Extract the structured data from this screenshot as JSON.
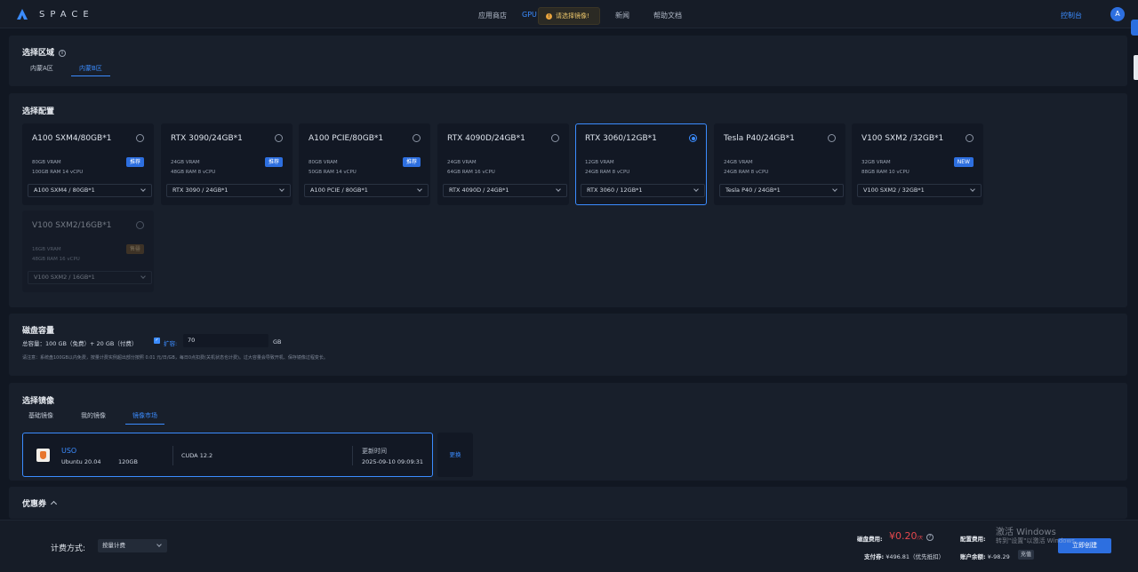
{
  "header": {
    "logo_text": "SPACE",
    "nav": [
      "应用商店",
      "GPU",
      "新闻",
      "帮助文档"
    ],
    "active_nav": "GPU",
    "console": "控制台",
    "avatar": "A",
    "toast": "请选择镜像!"
  },
  "region": {
    "title": "选择区域",
    "tabs": [
      "内蒙A区",
      "内蒙B区"
    ],
    "active_tab": "内蒙B区"
  },
  "config": {
    "title": "选择配置",
    "cards": [
      {
        "name": "A100 SXM4/80GB*1",
        "vram": "80GB VRAM",
        "specs": "100GB RAM 14 vCPU",
        "badge": "推荐",
        "option": "A100 SXM4 / 80GB*1",
        "selected": false
      },
      {
        "name": "RTX 3090/24GB*1",
        "vram": "24GB VRAM",
        "specs": "48GB RAM 8 vCPU",
        "badge": "推荐",
        "option": "RTX 3090 / 24GB*1",
        "selected": false
      },
      {
        "name": "A100 PCIE/80GB*1",
        "vram": "80GB VRAM",
        "specs": "50GB RAM 14 vCPU",
        "badge": "推荐",
        "option": "A100 PCIE / 80GB*1",
        "selected": false
      },
      {
        "name": "RTX 4090D/24GB*1",
        "vram": "24GB VRAM",
        "specs": "64GB RAM 16 vCPU",
        "badge": "",
        "option": "RTX 4090D / 24GB*1",
        "selected": false
      },
      {
        "name": "RTX 3060/12GB*1",
        "vram": "12GB VRAM",
        "specs": "24GB RAM 8 vCPU",
        "badge": "",
        "option": "RTX 3060 / 12GB*1",
        "selected": true
      },
      {
        "name": "Tesla P40/24GB*1",
        "vram": "24GB VRAM",
        "specs": "24GB RAM 8 vCPU",
        "badge": "",
        "option": "Tesla P40 / 24GB*1",
        "selected": false
      },
      {
        "name": "V100 SXM2 /32GB*1",
        "vram": "32GB VRAM",
        "specs": "88GB RAM 10 vCPU",
        "badge": "NEW",
        "option": "V100 SXM2 / 32GB*1",
        "selected": false
      },
      {
        "name": "V100 SXM2/16GB*1",
        "vram": "16GB VRAM",
        "specs": "48GB RAM 16 vCPU",
        "badge": "售罄",
        "option": "V100 SXM2 / 16GB*1",
        "selected": false,
        "disabled": true
      }
    ]
  },
  "disk": {
    "title": "磁盘容量",
    "total": "总容量：100 GB（免费）+ 20 GB（付费）",
    "expand_label": "扩容:",
    "expand_value": "70",
    "unit": "GB",
    "note": "请注意：系统盘100GB以内免费，按量计费实例超出部分按照 0.01 元/日/GB，每日0点扣费(关机状态也计费)。过大容量会导致开机、保存镜像过程变长。"
  },
  "image": {
    "title": "选择镜像",
    "tabs": [
      "基础镜像",
      "我的镜像",
      "镜像市场"
    ],
    "active_tab": "镜像市场",
    "name": "USO",
    "os": "Ubuntu 20.04",
    "size": "120GB",
    "cuda": "CUDA 12.2",
    "updated_label": "更新时间",
    "updated_value": "2025-09-10 09:09:31",
    "change": "更换"
  },
  "coupon": {
    "title": "优惠券"
  },
  "footer": {
    "billing_label": "计费方式:",
    "billing_value": "按量计费",
    "disk_fee_label": "磁盘费用:",
    "disk_fee_value": "¥0.20",
    "disk_fee_unit": "/天",
    "config_fee_label": "配置费用:",
    "pay_label": "支付券:",
    "pay_value": "¥496.81（优先抵扣）",
    "balance_label": "账户余额:",
    "balance_value": "¥-98.29",
    "recharge": "充值",
    "create": "立即创建"
  },
  "watermark": {
    "line1": "激活 Windows",
    "line2": "转到\"设置\"以激活 Windows。"
  },
  "colors": {
    "accent": "#3b8cff",
    "danger": "#e5484d",
    "background": "#111722",
    "panel": "#181f2b"
  }
}
